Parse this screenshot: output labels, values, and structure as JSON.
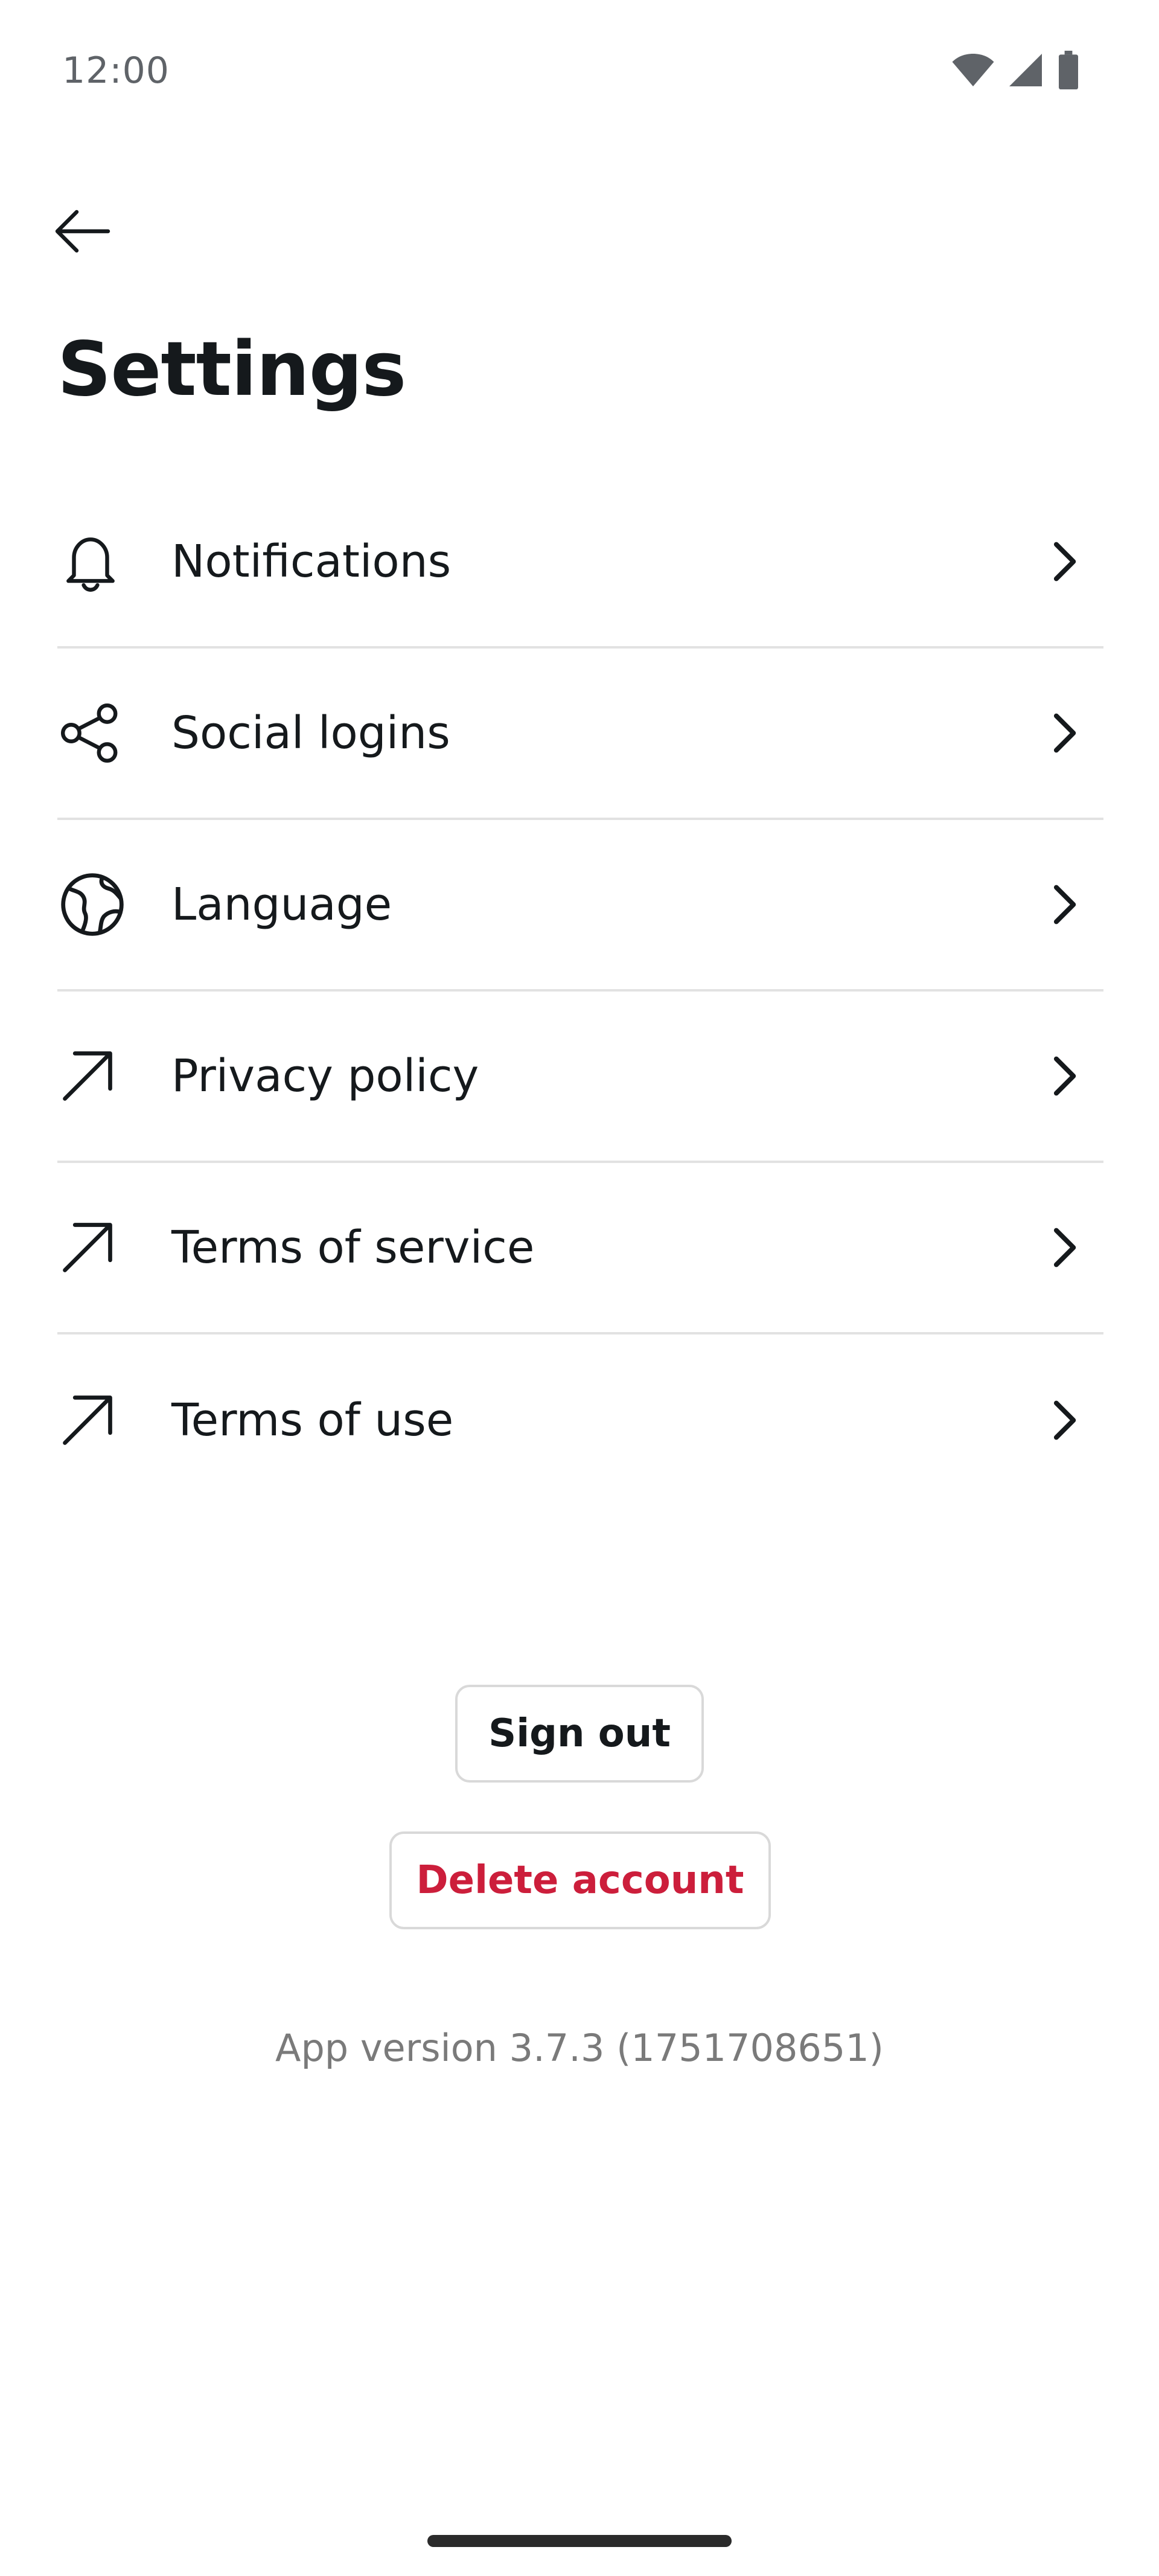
{
  "status_bar": {
    "time": "12:00",
    "icons": [
      "wifi-icon",
      "cellular-signal-icon",
      "battery-icon"
    ]
  },
  "header": {
    "back_icon": "arrow-left-icon",
    "title": "Settings"
  },
  "settings": {
    "items": [
      {
        "label": "Notifications",
        "icon": "bell-icon"
      },
      {
        "label": "Social logins",
        "icon": "share-icon"
      },
      {
        "label": "Language",
        "icon": "globe-icon"
      },
      {
        "label": "Privacy policy",
        "icon": "external-link-icon"
      },
      {
        "label": "Terms of service",
        "icon": "external-link-icon"
      },
      {
        "label": "Terms of use",
        "icon": "external-link-icon"
      }
    ]
  },
  "actions": {
    "sign_out_label": "Sign out",
    "delete_account_label": "Delete account"
  },
  "footer": {
    "app_version": "App version 3.7.3 (1751708651)"
  },
  "colors": {
    "text_primary": "#15191c",
    "danger": "#cc1e3b",
    "divider": "#e2e2e2",
    "muted": "#7a7a7a"
  }
}
